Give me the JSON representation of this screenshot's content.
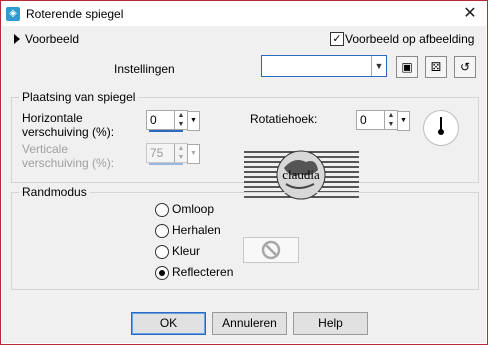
{
  "window": {
    "title": "Roterende spiegel",
    "close_glyph": "✕",
    "icon": "app-icon"
  },
  "top": {
    "preview_toggle": "Voorbeeld",
    "preview_on_image": {
      "label": "Voorbeeld op afbeelding",
      "checked": true
    },
    "settings_label": "Instellingen",
    "settings_value": "",
    "icons": [
      "save-icon",
      "random-dice-icon",
      "reset-icon"
    ]
  },
  "placement": {
    "title": "Plaatsing van spiegel",
    "horizontal": {
      "label_line1": "Horizontale",
      "label_line2": "verschuiving (%):",
      "value": "0",
      "fill": 0.95
    },
    "vertical": {
      "label_line1": "Verticale",
      "label_line2": "verschuiving (%):",
      "value": "75",
      "fill": 0.95,
      "disabled": true
    },
    "rotation": {
      "label": "Rotatiehoek:",
      "value": "0"
    },
    "logo_text": "claudia"
  },
  "edge": {
    "title": "Randmodus",
    "options": [
      {
        "label": "Omloop",
        "selected": false
      },
      {
        "label": "Herhalen",
        "selected": false
      },
      {
        "label": "Kleur",
        "selected": false
      },
      {
        "label": "Reflecteren",
        "selected": true
      }
    ]
  },
  "buttons": {
    "ok": "OK",
    "cancel": "Annuleren",
    "help": "Help"
  }
}
